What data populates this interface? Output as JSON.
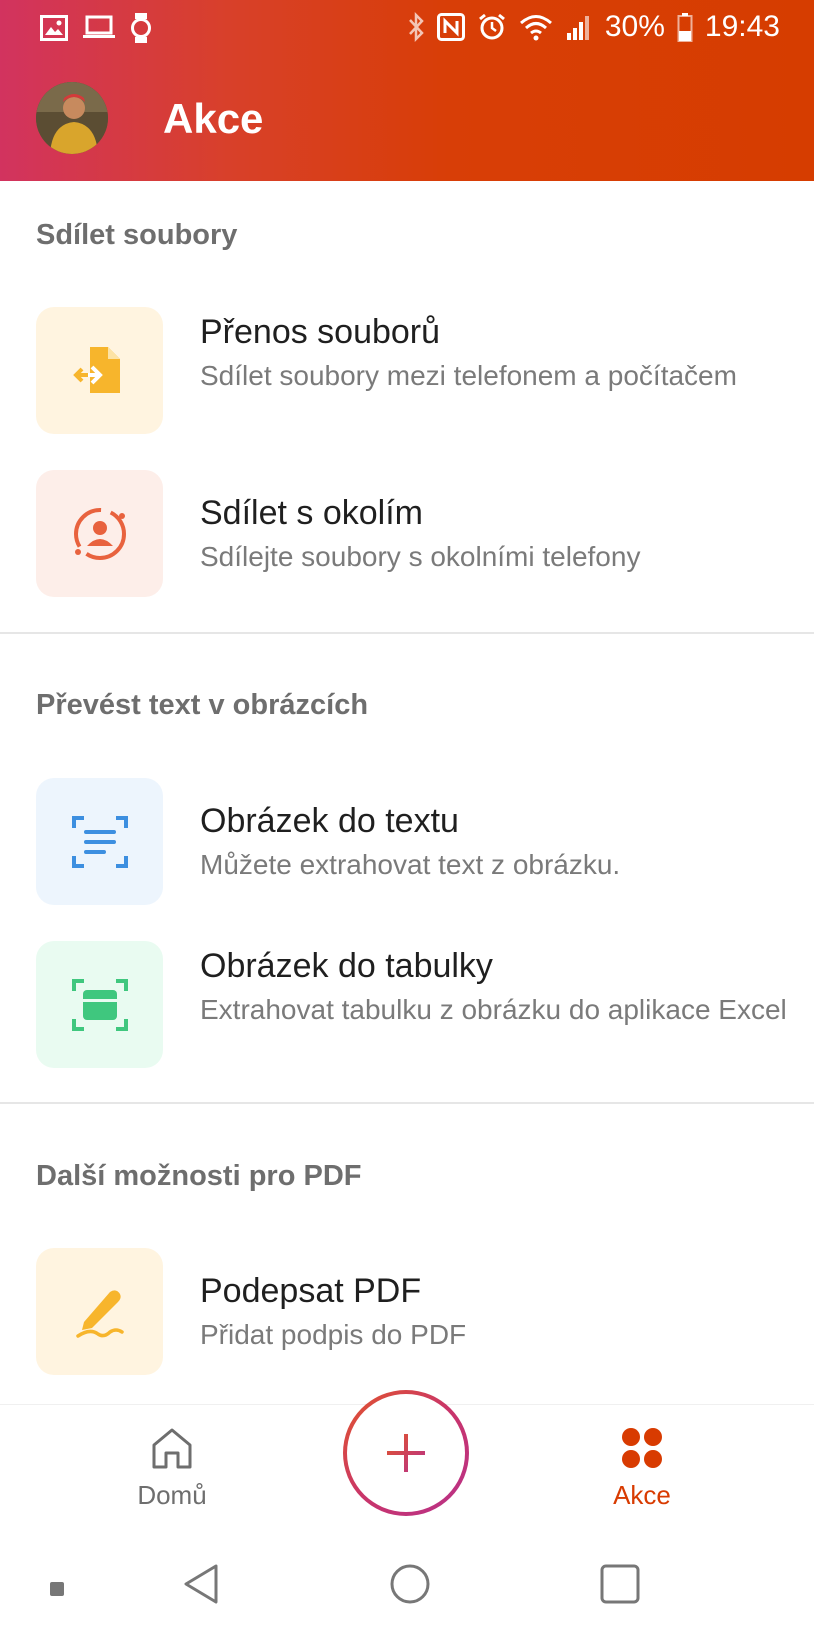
{
  "statusbar": {
    "battery_percent": "30%",
    "time": "19:43"
  },
  "header": {
    "title": "Akce"
  },
  "sections": [
    {
      "title": "Sdílet soubory",
      "items": [
        {
          "title": "Přenos souborů",
          "subtitle": "Sdílet soubory mezi telefonem a počítačem",
          "icon": "file-transfer-icon",
          "color": "#f7b52c",
          "bg": "#fff4e0"
        },
        {
          "title": "Sdílet s okolím",
          "subtitle": "Sdílejte soubory s okolními telefony",
          "icon": "share-nearby-icon",
          "color": "#e8623e",
          "bg": "#fdeee9"
        }
      ]
    },
    {
      "title": "Převést text v obrázcích",
      "items": [
        {
          "title": "Obrázek do textu",
          "subtitle": "Můžete extrahovat text z obrázku.",
          "icon": "image-to-text-icon",
          "color": "#3d8fe0",
          "bg": "#edf5fd"
        },
        {
          "title": "Obrázek do tabulky",
          "subtitle": "Extrahovat tabulku z obrázku do aplikace Excel",
          "icon": "image-to-table-icon",
          "color": "#3fc77e",
          "bg": "#e9fbf1"
        }
      ]
    },
    {
      "title": "Další možnosti pro PDF",
      "items": [
        {
          "title": "Podepsat PDF",
          "subtitle": "Přidat podpis do PDF",
          "icon": "sign-pdf-icon",
          "color": "#f7b52c",
          "bg": "#fff4e0"
        }
      ]
    }
  ],
  "bottomnav": {
    "home_label": "Domů",
    "actions_label": "Akce",
    "active_color": "#d83b01",
    "inactive_color": "#6e6e6e"
  }
}
